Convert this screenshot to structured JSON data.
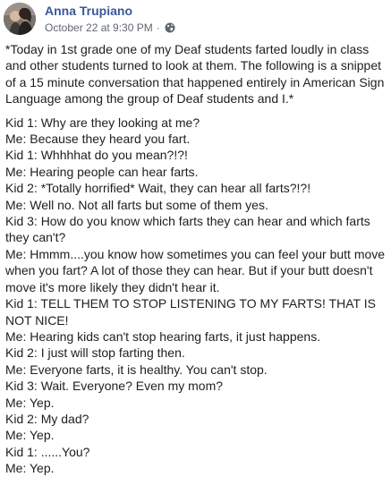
{
  "post": {
    "author": "Anna Trupiano",
    "date": "October 22 at 9:30 PM",
    "separator": "·",
    "privacy_icon": "globe-icon",
    "intro": "*Today in 1st grade one of my Deaf students farted loudly in class and other students turned to look at them. The following is a snippet of a 15 minute conversation that happened entirely in American Sign Language among the group of Deaf students and I.*",
    "lines": [
      "Kid 1: Why are they looking at me?",
      "Me: Because they heard you fart.",
      "Kid 1: Whhhhat do you mean?!?!",
      "Me: Hearing people can hear farts.",
      "Kid 2: *Totally horrified* Wait, they can hear all farts?!?!",
      "Me: Well no. Not all farts but some of them yes.",
      "Kid 3: How do you know which farts they can hear and which farts they can't?",
      "Me: Hmmm....you know how sometimes you can feel your butt move when you fart? A lot of those they can hear. But if your butt doesn't move it's more likely they didn't hear it.",
      "Kid 1: TELL THEM TO STOP LISTENING TO MY FARTS! THAT IS NOT NICE!",
      "Me: Hearing kids can't stop hearing farts, it just happens.",
      "Kid 2: I just will stop farting then.",
      "Me: Everyone farts, it is healthy. You can't stop.",
      "Kid 3: Wait. Everyone? Even my mom?",
      "Me: Yep.",
      "Kid 2: My dad?",
      "Me: Yep.",
      "Kid 1: ......You?",
      "Me: Yep."
    ]
  },
  "colors": {
    "author": "#385898",
    "meta": "#616770",
    "text": "#1c1e21"
  }
}
